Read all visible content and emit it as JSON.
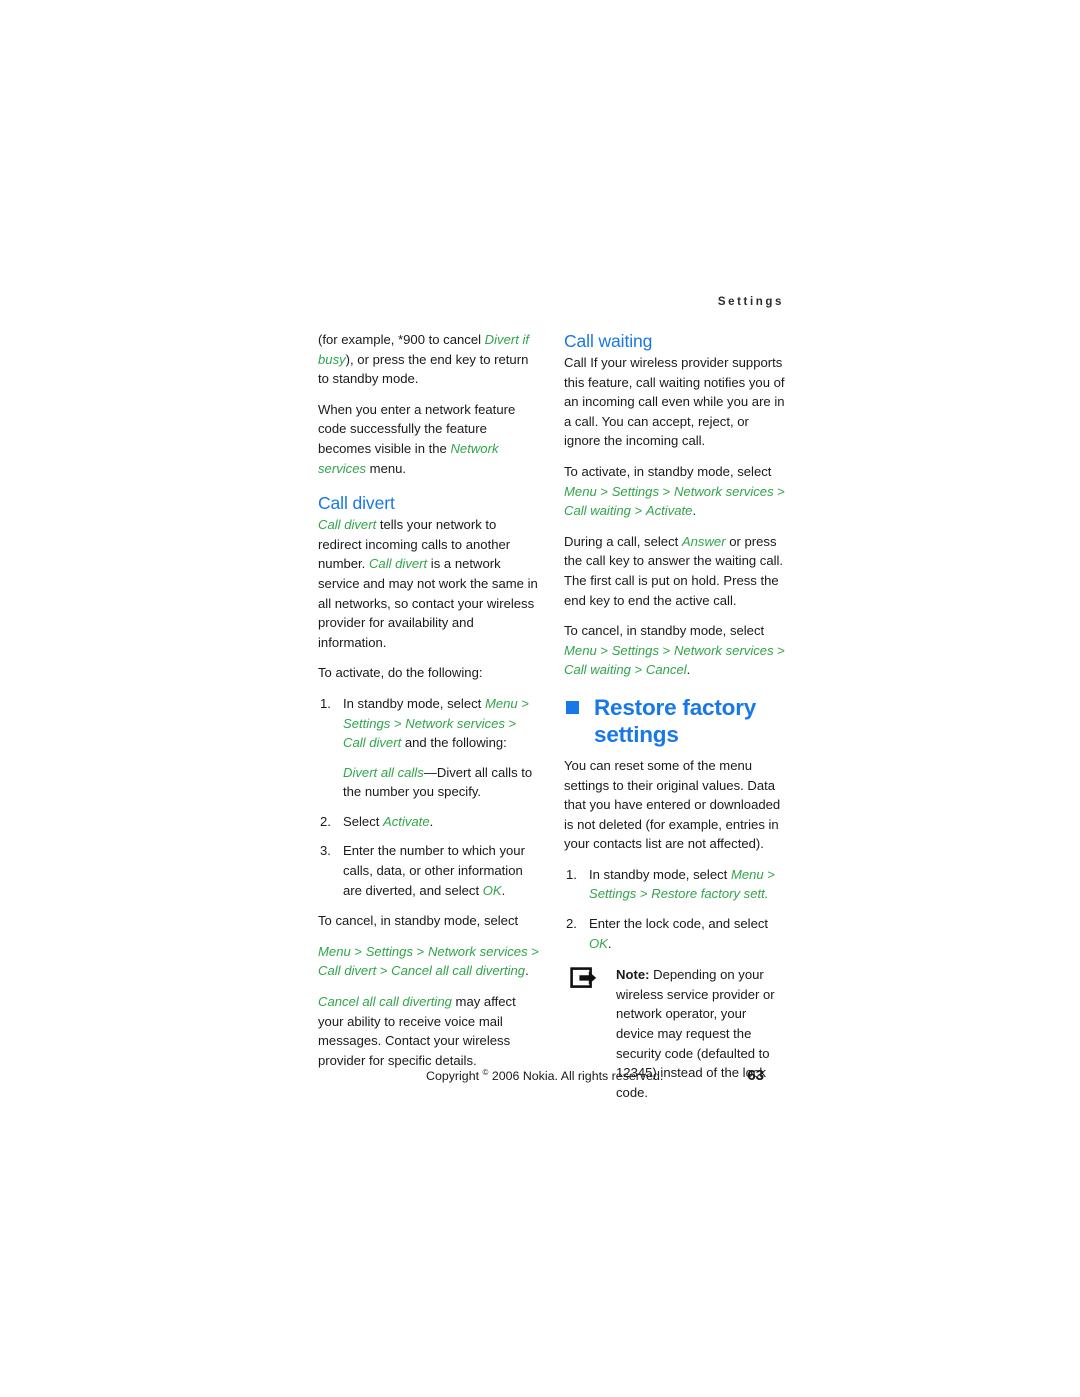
{
  "header": {
    "running_head": "Settings"
  },
  "left_column": {
    "para_1_a": "(for example, *900 to cancel ",
    "para_1_i": "Divert if busy",
    "para_1_b": "), or press the end key to return to standby mode.",
    "para_2_a": "When you enter a network feature code successfully the feature becomes visible in the ",
    "para_2_i": "Network services",
    "para_2_b": " menu.",
    "heading_call_divert": "Call divert",
    "cd_para_a_i": "Call divert",
    "cd_para_a": " tells your network to redirect incoming calls to another number. ",
    "cd_para_b_i": "Call divert",
    "cd_para_b": " is a network service and may not work the same in all networks, so contact your wireless provider for availability and information.",
    "cd_activate_lead": "To activate, do the following:",
    "step1_num": "1.",
    "step1_a": "In standby mode, select ",
    "step1_menu": "Menu",
    "step1_gt1": " > ",
    "step1_settings": "Settings",
    "step1_gt2": " > ",
    "step1_netsvc": "Network services",
    "step1_gt3": " > ",
    "step1_calldivert": "Call divert",
    "step1_tail": " and the following:",
    "step1_sub_i": "Divert all calls",
    "step1_sub_b": "—Divert all calls to the number you specify.",
    "step2_num": "2.",
    "step2_a": "Select ",
    "step2_i": "Activate",
    "step2_b": ".",
    "step3_num": "3.",
    "step3_a": "Enter the number to which your calls, data, or other information are diverted, and select ",
    "step3_i": "OK",
    "step3_b": ".",
    "cancel_lead": "To cancel, in standby mode, select",
    "cancel_menu": "Menu",
    "cancel_gt1": " > ",
    "cancel_settings": "Settings",
    "cancel_gt2": " > ",
    "cancel_netsvc": "Network services",
    "cancel_gt3": " > ",
    "cancel_calldivert": "Call divert",
    "cancel_gt4": " > ",
    "cancel_cancelall": "Cancel all call diverting",
    "cancel_period": ".",
    "warn_i": "Cancel all call diverting",
    "warn_b": " may affect your ability to receive voice mail messages. Contact your wireless provider for specific details."
  },
  "right_column": {
    "heading_call_waiting": "Call waiting",
    "cw_para_1": "Call If your wireless provider supports this feature, call waiting notifies you of an incoming call even while you are in a call. You can accept, reject, or ignore the incoming call.",
    "cw_activate_lead": "To activate, in standby mode, select",
    "cw_act_menu": "Menu",
    "cw_act_gt1": " > ",
    "cw_act_settings": "Settings",
    "cw_act_gt2": " > ",
    "cw_act_netsvc": "Network services",
    "cw_act_gt3": " > ",
    "cw_act_callwaiting": "Call waiting",
    "cw_act_gt4": " > ",
    "cw_act_activate": "Activate",
    "cw_act_period": ".",
    "cw_during_a": "During a call, select ",
    "cw_during_i": "Answer",
    "cw_during_b": " or press the call key to answer the waiting call. The first call is put on hold. Press the end key to end the active call.",
    "cw_cancel_lead": "To cancel, in standby mode, select",
    "cw_can_menu": "Menu",
    "cw_can_gt1": " > ",
    "cw_can_settings": "Settings",
    "cw_can_gt2": " > ",
    "cw_can_netsvc": "Network services",
    "cw_can_gt3": " > ",
    "cw_can_callwaiting": "Call waiting",
    "cw_can_gt4": " > ",
    "cw_can_cancel": "Cancel",
    "cw_can_period": ".",
    "heading_restore": "Restore factory settings",
    "rf_para_1": "You can reset some of the menu settings to their original values. Data that you have entered or downloaded is not deleted (for example, entries in your contacts list are not affected).",
    "rf_step1_num": "1.",
    "rf_step1_a": "In standby mode, select ",
    "rf_step1_menu": "Menu",
    "rf_step1_gt1": " > ",
    "rf_step1_settings": "Settings",
    "rf_step1_gt2": " > ",
    "rf_step1_restore": "Restore factory sett.",
    "rf_step2_num": "2.",
    "rf_step2_a": "Enter the lock code, and select ",
    "rf_step2_i": "OK",
    "rf_step2_b": ".",
    "note_label": "Note:",
    "note_text": " Depending on your wireless service provider or network operator, your device may request the security code (defaulted to 12345) instead of the lock code.",
    "note_icon": "note-arrow-icon"
  },
  "footer": {
    "copyright_pre": "Copyright ",
    "copyright_sym": "©",
    "copyright_post": " 2006 Nokia. All rights reserved.",
    "page_number": "63"
  },
  "colors": {
    "heading_blue": "#1878e8",
    "menu_green": "#31a54a",
    "body_black": "#1a1a1a"
  }
}
